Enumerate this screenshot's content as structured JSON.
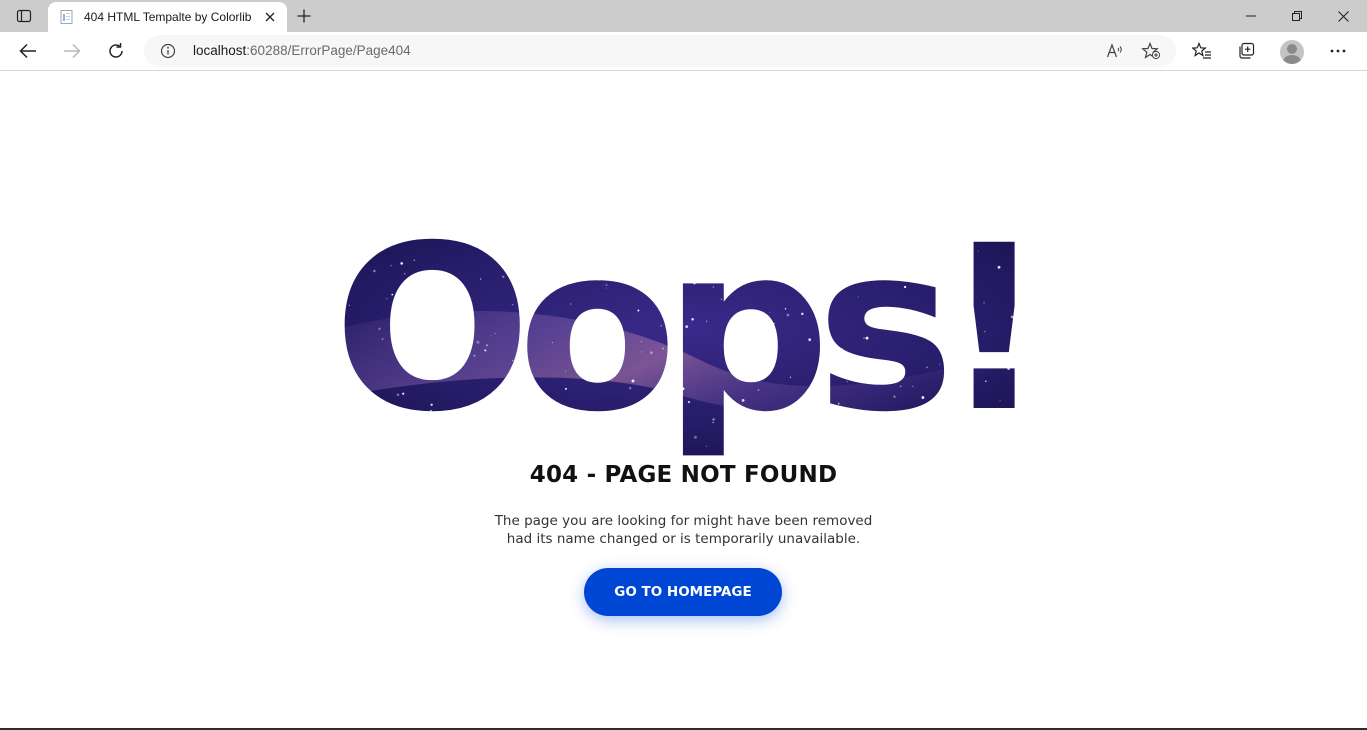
{
  "browser": {
    "tab": {
      "title": "404 HTML Tempalte by Colorlib"
    },
    "address": {
      "host": "localhost",
      "rest": ":60288/ErrorPage/Page404"
    },
    "icons": {
      "tab_actions": "tab-actions-icon",
      "favicon": "page-favicon-icon",
      "close": "close-icon",
      "new_tab": "plus-icon",
      "minimize": "minimize-icon",
      "restore": "restore-icon",
      "window_close": "close-icon",
      "back": "back-arrow-icon",
      "forward": "forward-arrow-icon",
      "refresh": "refresh-icon",
      "site_info": "info-icon",
      "read_aloud": "read-aloud-icon",
      "add_favorite": "star-add-icon",
      "favorites": "favorites-icon",
      "collections": "collections-icon",
      "profile": "profile-avatar",
      "menu": "more-icon"
    }
  },
  "page": {
    "hero": "Oops!",
    "title": "404 - PAGE NOT FOUND",
    "message_line1": "The page you are looking for might have been removed",
    "message_line2": "had its name changed or is temporarily unavailable.",
    "button_label": "GO TO HOMEPAGE"
  },
  "colors": {
    "chrome_bg": "#cccccc",
    "button_bg": "#0046d5",
    "space_dark": "#1b1452",
    "space_mid": "#3a2a8a",
    "space_glow": "#7a5aa8"
  }
}
